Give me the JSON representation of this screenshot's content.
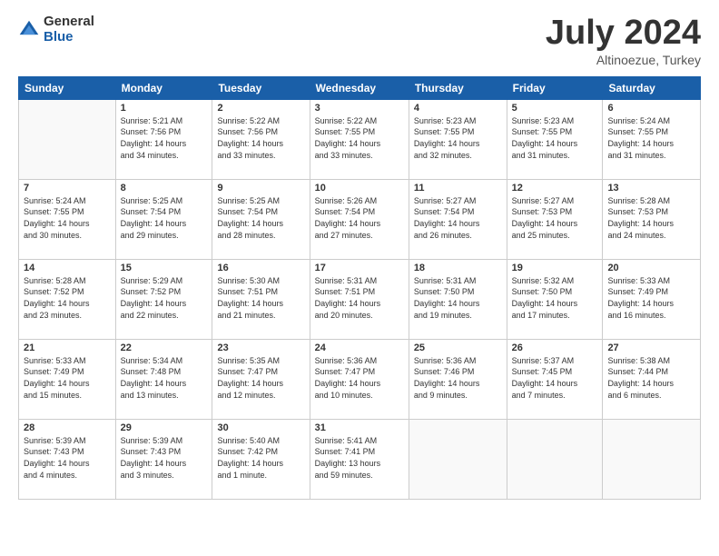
{
  "logo": {
    "general": "General",
    "blue": "Blue"
  },
  "title": "July 2024",
  "subtitle": "Altinoezue, Turkey",
  "headers": [
    "Sunday",
    "Monday",
    "Tuesday",
    "Wednesday",
    "Thursday",
    "Friday",
    "Saturday"
  ],
  "weeks": [
    [
      {
        "day": "",
        "info": ""
      },
      {
        "day": "1",
        "info": "Sunrise: 5:21 AM\nSunset: 7:56 PM\nDaylight: 14 hours\nand 34 minutes."
      },
      {
        "day": "2",
        "info": "Sunrise: 5:22 AM\nSunset: 7:56 PM\nDaylight: 14 hours\nand 33 minutes."
      },
      {
        "day": "3",
        "info": "Sunrise: 5:22 AM\nSunset: 7:55 PM\nDaylight: 14 hours\nand 33 minutes."
      },
      {
        "day": "4",
        "info": "Sunrise: 5:23 AM\nSunset: 7:55 PM\nDaylight: 14 hours\nand 32 minutes."
      },
      {
        "day": "5",
        "info": "Sunrise: 5:23 AM\nSunset: 7:55 PM\nDaylight: 14 hours\nand 31 minutes."
      },
      {
        "day": "6",
        "info": "Sunrise: 5:24 AM\nSunset: 7:55 PM\nDaylight: 14 hours\nand 31 minutes."
      }
    ],
    [
      {
        "day": "7",
        "info": "Sunrise: 5:24 AM\nSunset: 7:55 PM\nDaylight: 14 hours\nand 30 minutes."
      },
      {
        "day": "8",
        "info": "Sunrise: 5:25 AM\nSunset: 7:54 PM\nDaylight: 14 hours\nand 29 minutes."
      },
      {
        "day": "9",
        "info": "Sunrise: 5:25 AM\nSunset: 7:54 PM\nDaylight: 14 hours\nand 28 minutes."
      },
      {
        "day": "10",
        "info": "Sunrise: 5:26 AM\nSunset: 7:54 PM\nDaylight: 14 hours\nand 27 minutes."
      },
      {
        "day": "11",
        "info": "Sunrise: 5:27 AM\nSunset: 7:54 PM\nDaylight: 14 hours\nand 26 minutes."
      },
      {
        "day": "12",
        "info": "Sunrise: 5:27 AM\nSunset: 7:53 PM\nDaylight: 14 hours\nand 25 minutes."
      },
      {
        "day": "13",
        "info": "Sunrise: 5:28 AM\nSunset: 7:53 PM\nDaylight: 14 hours\nand 24 minutes."
      }
    ],
    [
      {
        "day": "14",
        "info": "Sunrise: 5:28 AM\nSunset: 7:52 PM\nDaylight: 14 hours\nand 23 minutes."
      },
      {
        "day": "15",
        "info": "Sunrise: 5:29 AM\nSunset: 7:52 PM\nDaylight: 14 hours\nand 22 minutes."
      },
      {
        "day": "16",
        "info": "Sunrise: 5:30 AM\nSunset: 7:51 PM\nDaylight: 14 hours\nand 21 minutes."
      },
      {
        "day": "17",
        "info": "Sunrise: 5:31 AM\nSunset: 7:51 PM\nDaylight: 14 hours\nand 20 minutes."
      },
      {
        "day": "18",
        "info": "Sunrise: 5:31 AM\nSunset: 7:50 PM\nDaylight: 14 hours\nand 19 minutes."
      },
      {
        "day": "19",
        "info": "Sunrise: 5:32 AM\nSunset: 7:50 PM\nDaylight: 14 hours\nand 17 minutes."
      },
      {
        "day": "20",
        "info": "Sunrise: 5:33 AM\nSunset: 7:49 PM\nDaylight: 14 hours\nand 16 minutes."
      }
    ],
    [
      {
        "day": "21",
        "info": "Sunrise: 5:33 AM\nSunset: 7:49 PM\nDaylight: 14 hours\nand 15 minutes."
      },
      {
        "day": "22",
        "info": "Sunrise: 5:34 AM\nSunset: 7:48 PM\nDaylight: 14 hours\nand 13 minutes."
      },
      {
        "day": "23",
        "info": "Sunrise: 5:35 AM\nSunset: 7:47 PM\nDaylight: 14 hours\nand 12 minutes."
      },
      {
        "day": "24",
        "info": "Sunrise: 5:36 AM\nSunset: 7:47 PM\nDaylight: 14 hours\nand 10 minutes."
      },
      {
        "day": "25",
        "info": "Sunrise: 5:36 AM\nSunset: 7:46 PM\nDaylight: 14 hours\nand 9 minutes."
      },
      {
        "day": "26",
        "info": "Sunrise: 5:37 AM\nSunset: 7:45 PM\nDaylight: 14 hours\nand 7 minutes."
      },
      {
        "day": "27",
        "info": "Sunrise: 5:38 AM\nSunset: 7:44 PM\nDaylight: 14 hours\nand 6 minutes."
      }
    ],
    [
      {
        "day": "28",
        "info": "Sunrise: 5:39 AM\nSunset: 7:43 PM\nDaylight: 14 hours\nand 4 minutes."
      },
      {
        "day": "29",
        "info": "Sunrise: 5:39 AM\nSunset: 7:43 PM\nDaylight: 14 hours\nand 3 minutes."
      },
      {
        "day": "30",
        "info": "Sunrise: 5:40 AM\nSunset: 7:42 PM\nDaylight: 14 hours\nand 1 minute."
      },
      {
        "day": "31",
        "info": "Sunrise: 5:41 AM\nSunset: 7:41 PM\nDaylight: 13 hours\nand 59 minutes."
      },
      {
        "day": "",
        "info": ""
      },
      {
        "day": "",
        "info": ""
      },
      {
        "day": "",
        "info": ""
      }
    ]
  ]
}
